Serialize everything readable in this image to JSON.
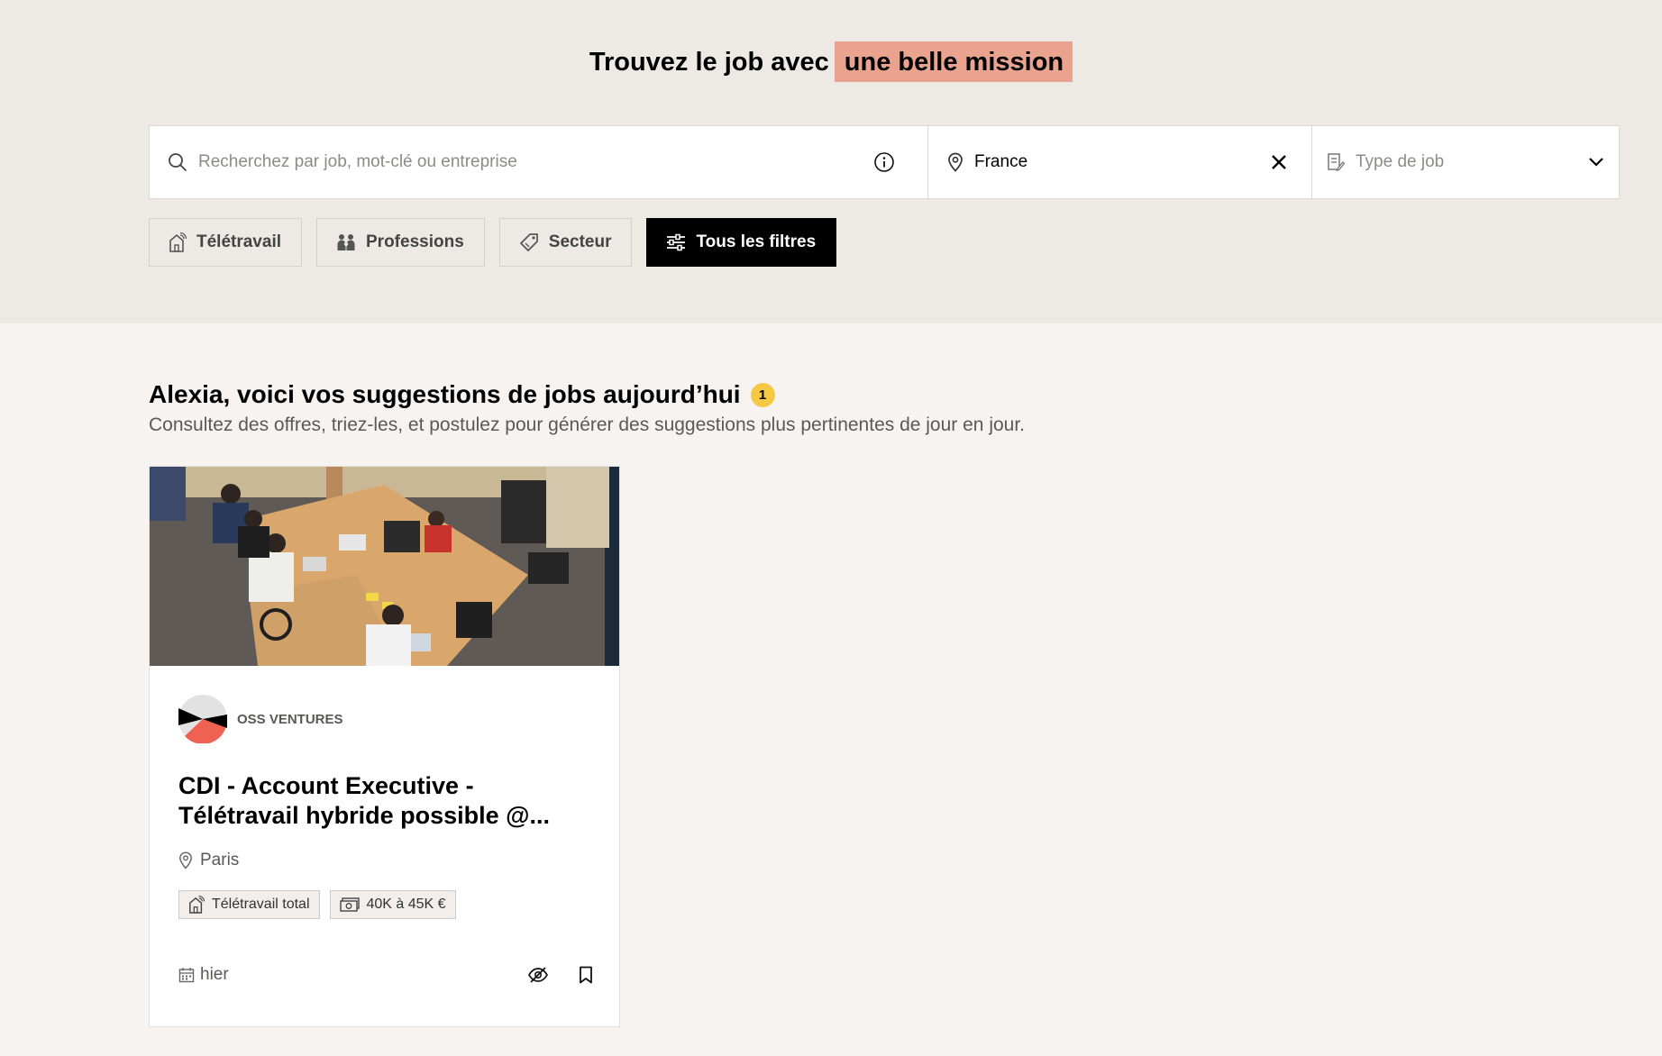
{
  "hero": {
    "title_prefix": "Trouvez le job avec",
    "title_highlight": "une belle mission",
    "highlight_color": "#e9a38f"
  },
  "search": {
    "query_placeholder": "Recherchez par job, mot-clé ou entreprise",
    "location_value": "France",
    "job_type_placeholder": "Type de job",
    "icons": [
      "search-icon",
      "info-icon",
      "location-pin-icon",
      "clear-icon",
      "job-type-icon",
      "chevron-down-icon"
    ]
  },
  "filters": [
    {
      "label": "Télétravail",
      "icon": "remote-home-icon"
    },
    {
      "label": "Professions",
      "icon": "people-icon"
    },
    {
      "label": "Secteur",
      "icon": "tag-icon"
    },
    {
      "label": "Tous les filtres",
      "icon": "sliders-icon"
    }
  ],
  "suggestions": {
    "title": "Alexia, voici vos suggestions de jobs aujourd’hui",
    "badge_count": "1",
    "badge_color": "#f6c945",
    "subtitle": "Consultez des offres, triez-les, et postulez pour générer des suggestions plus pertinentes de jour en jour."
  },
  "job_card": {
    "company": "OSS VENTURES",
    "title": "CDI - Account Executive - Télétravail hybride possible @...",
    "location": "Paris",
    "tags": [
      {
        "label": "Télétravail total",
        "icon": "remote-home-icon"
      },
      {
        "label": "40K à 45K €",
        "icon": "money-icon"
      }
    ],
    "date": "hier",
    "actions": [
      "hide-icon",
      "bookmark-icon"
    ]
  },
  "colors": {
    "hero_bg": "#ede9e5",
    "page_bg": "#f6f3f0",
    "primary_button": "#000000"
  }
}
